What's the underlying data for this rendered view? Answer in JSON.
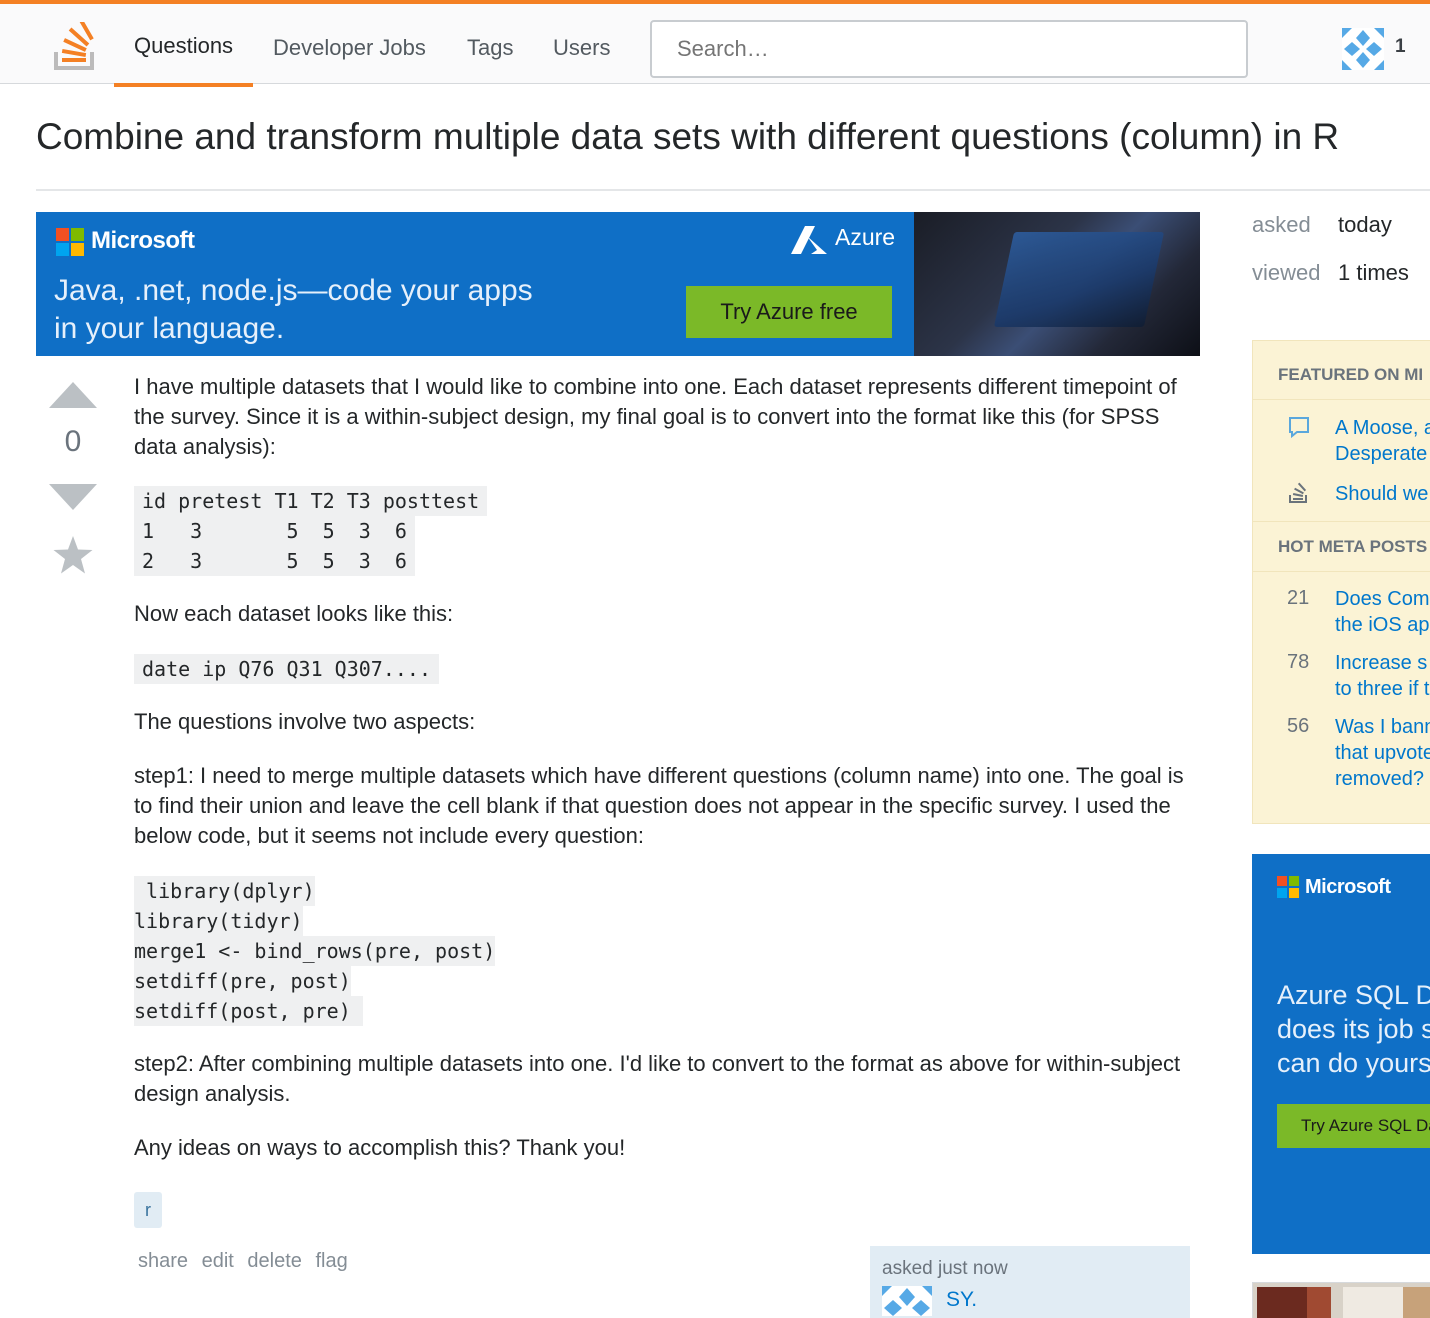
{
  "header": {
    "nav": [
      "Questions",
      "Developer Jobs",
      "Tags",
      "Users"
    ],
    "search_placeholder": "Search…",
    "reputation": "1"
  },
  "question": {
    "title": "Combine and transform multiple data sets with different questions (column) in R",
    "votes": "0",
    "body": {
      "p1": "I have multiple datasets that I would like to combine into one. Each dataset represents different timepoint of the survey. Since it is a within-subject design, my final goal is to convert into the format like this (for SPSS data analysis):",
      "code1": [
        "id pretest T1 T2 T3 posttest",
        "1   3       5  5  3  6",
        "2   3       5  5  3  6"
      ],
      "p2": "Now each dataset looks like this:",
      "code2": "date ip Q76 Q31 Q307....",
      "p3": "The questions involve two aspects:",
      "p4": "step1: I need to merge multiple datasets which have different questions (column name) into one. The goal is to find their union and leave the cell blank if that question does not appear in the specific survey. I used the below code, but it seems not include every question:",
      "code3": [
        " library(dplyr)",
        "library(tidyr)",
        "merge1 <- bind_rows(pre, post)",
        "setdiff(pre, post)",
        "setdiff(post, pre) "
      ],
      "p5": "step2: After combining multiple datasets into one. I'd like to convert to the format as above for within-subject design analysis.",
      "p6": "Any ideas on ways to accomplish this? Thank you!"
    },
    "tags": [
      "r"
    ],
    "menu": [
      "share",
      "edit",
      "delete",
      "flag"
    ],
    "owner": {
      "asked": "asked just now",
      "name": "SY."
    }
  },
  "ad": {
    "brand": "Microsoft",
    "product": "Azure",
    "text": [
      "Java, .net, node.js—code your apps",
      "in your language."
    ],
    "cta": "Try Azure free"
  },
  "sidebar": {
    "asked_label": "asked",
    "asked_value": "today",
    "viewed_label": "viewed",
    "viewed_value": "1 times",
    "featured_heading": "FEATURED ON MI",
    "featured": [
      {
        "lines": [
          "A Moose, a",
          "Desperate"
        ]
      },
      {
        "lines": [
          "Should we"
        ]
      }
    ],
    "hot_heading": "HOT META POSTS",
    "hot": [
      {
        "score": "21",
        "lines": [
          "Does Com",
          "the iOS ap"
        ]
      },
      {
        "score": "78",
        "lines": [
          "Increase s",
          "to three if t"
        ]
      },
      {
        "score": "56",
        "lines": [
          "Was I bann",
          "that upvote",
          "removed?"
        ]
      }
    ],
    "ad2": {
      "brand": "Microsoft",
      "text": [
        "Azure SQL Da",
        "does its job s",
        "can do yours."
      ],
      "cta": "Try Azure SQL Dat"
    }
  },
  "colors": {
    "accent": "#f48024",
    "link": "#0077cc",
    "ad_blue": "#0f6fc6",
    "ad_green": "#7bb928",
    "widget_bg": "#fbf3d5"
  }
}
